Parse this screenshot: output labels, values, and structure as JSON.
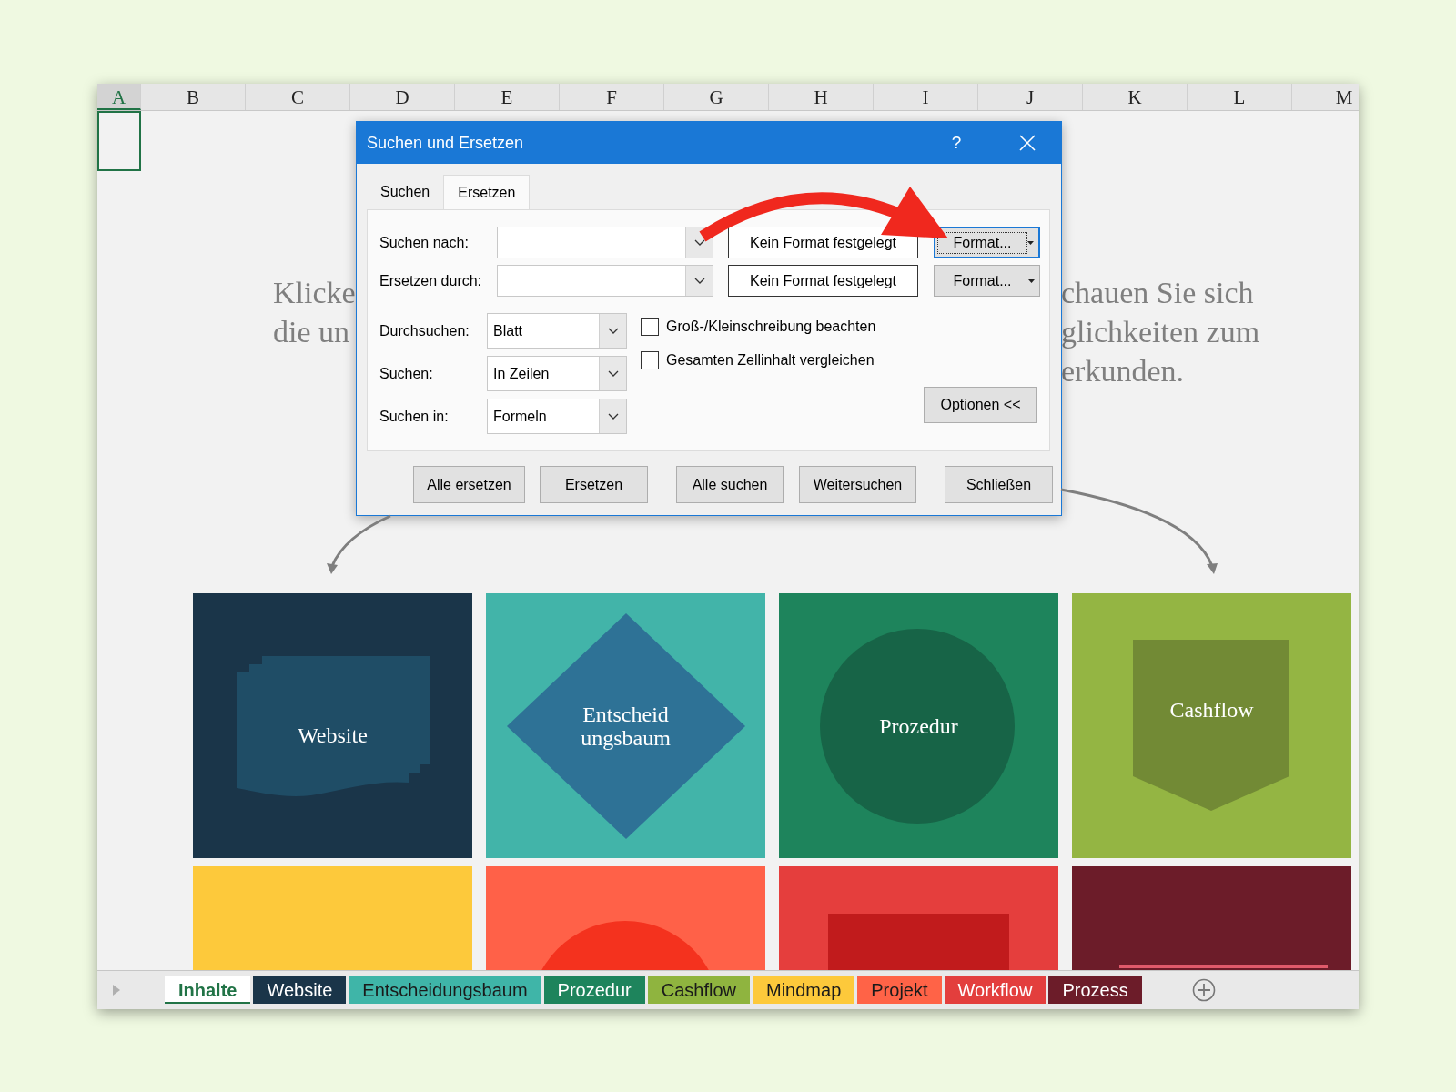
{
  "columns": [
    {
      "label": "A",
      "selected": true
    },
    {
      "label": "B",
      "selected": false
    },
    {
      "label": "C",
      "selected": false
    },
    {
      "label": "D",
      "selected": false
    },
    {
      "label": "E",
      "selected": false
    },
    {
      "label": "F",
      "selected": false
    },
    {
      "label": "G",
      "selected": false
    },
    {
      "label": "H",
      "selected": false
    },
    {
      "label": "I",
      "selected": false
    },
    {
      "label": "J",
      "selected": false
    },
    {
      "label": "K",
      "selected": false
    },
    {
      "label": "L",
      "selected": false
    },
    {
      "label": "M",
      "selected": false
    }
  ],
  "intro": {
    "left_lines": [
      "Klicke",
      "die un"
    ],
    "right_lines": [
      "chauen Sie sich",
      "glichkeiten zum",
      "erkunden."
    ]
  },
  "tiles": [
    {
      "kind": "document",
      "color": "#1a3549",
      "label_lines": [
        "Website"
      ]
    },
    {
      "kind": "diamond",
      "color": "#42b4a9",
      "label_lines": [
        "Entscheid",
        "ungsbaum"
      ]
    },
    {
      "kind": "circle",
      "color": "#1e845c",
      "label_lines": [
        "Prozedur"
      ]
    },
    {
      "kind": "pentagon",
      "color": "#94b543",
      "label_lines": [
        "Cashflow"
      ]
    },
    {
      "kind": "plain",
      "color": "#fdc93b"
    },
    {
      "kind": "semicircle",
      "color": "#ff6148"
    },
    {
      "kind": "rectangle",
      "color": "#e53e3d"
    },
    {
      "kind": "line",
      "color": "#6c1c29"
    }
  ],
  "dialog": {
    "title": "Suchen und Ersetzen",
    "help": "?",
    "tabs": [
      {
        "label": "Suchen",
        "selected": false
      },
      {
        "label": "Ersetzen",
        "selected": true
      }
    ],
    "replace_rows": [
      {
        "label": "Suchen nach:",
        "format_status": "Kein Format festgelegt",
        "format_button": "Format...",
        "focused": true
      },
      {
        "label": "Ersetzen durch:",
        "format_status": "Kein Format festgelegt",
        "format_button": "Format...",
        "focused": false
      }
    ],
    "options": [
      {
        "label": "Durchsuchen:",
        "value": "Blatt"
      },
      {
        "label": "Suchen:",
        "value": "In Zeilen"
      },
      {
        "label": "Suchen in:",
        "value": "Formeln"
      }
    ],
    "checkboxes": [
      {
        "label": "Groß-/Kleinschreibung beachten",
        "checked": false
      },
      {
        "label": "Gesamten Zellinhalt vergleichen",
        "checked": false
      }
    ],
    "options_button": "Optionen <<",
    "buttons": [
      "Alle ersetzen",
      "Ersetzen",
      "Alle suchen",
      "Weitersuchen",
      "Schließen"
    ]
  },
  "sheet_tabs": [
    {
      "label": "Inhalte",
      "selected": true
    },
    {
      "label": "Website",
      "selected": false,
      "color": "#1a3549"
    },
    {
      "label": "Entscheidungsbaum",
      "selected": false,
      "color": "#3fb5a8"
    },
    {
      "label": "Prozedur",
      "selected": false,
      "color": "#1e845c"
    },
    {
      "label": "Cashflow",
      "selected": false,
      "color": "#8fb43f"
    },
    {
      "label": "Mindmap",
      "selected": false,
      "color": "#fdc93b"
    },
    {
      "label": "Projekt",
      "selected": false,
      "color": "#ff6347"
    },
    {
      "label": "Workflow",
      "selected": false,
      "color": "#e33e3d"
    },
    {
      "label": "Prozess",
      "selected": false,
      "color": "#6c1c29"
    }
  ]
}
